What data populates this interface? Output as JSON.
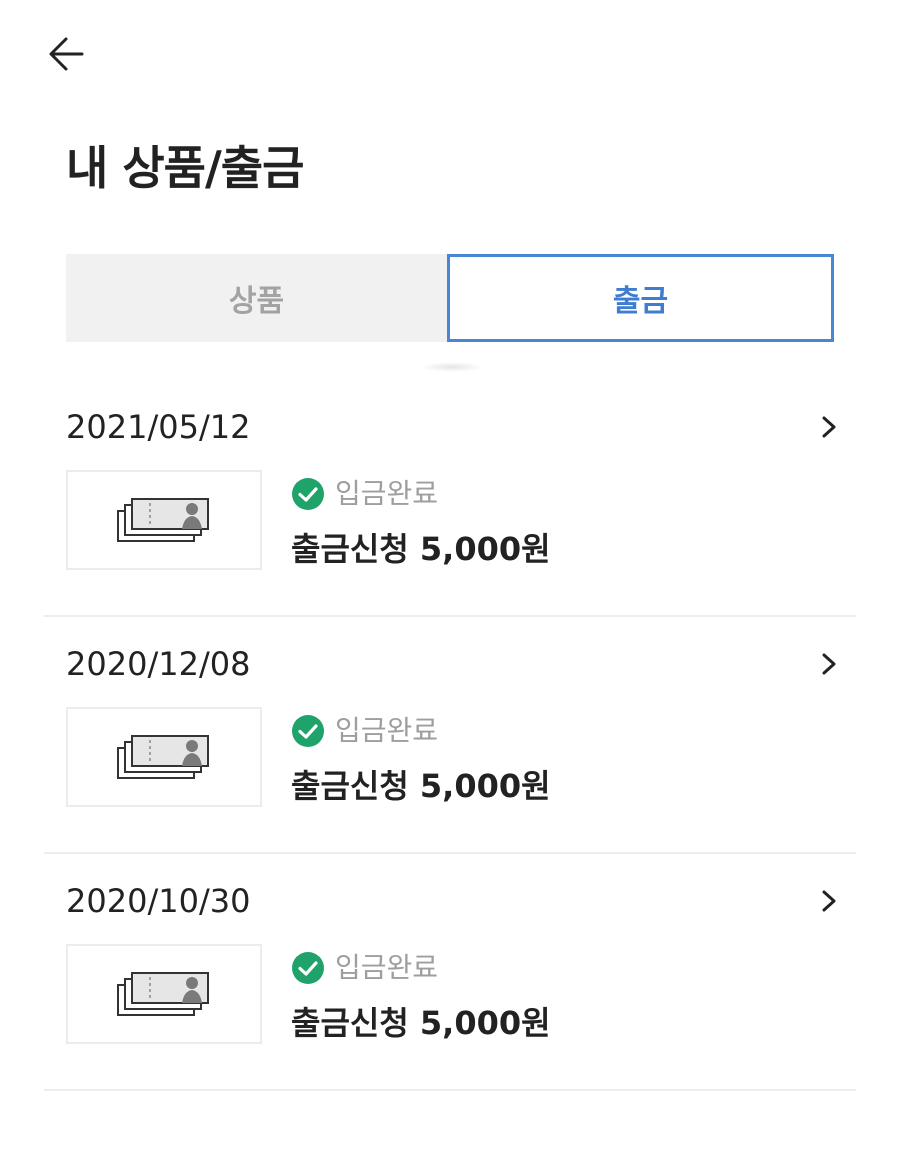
{
  "header": {
    "back_icon": "arrow-left-icon",
    "title": "내 상품/출금"
  },
  "tabs": [
    {
      "label": "상품",
      "active": false
    },
    {
      "label": "출금",
      "active": true
    }
  ],
  "colors": {
    "accent": "#4a86d4",
    "status_green": "#1fa36b",
    "inactive_tab_bg": "#f1f1f1"
  },
  "withdrawals": [
    {
      "date": "2021/05/12",
      "status": "입금완료",
      "amount": "출금신청 5,000원"
    },
    {
      "date": "2020/12/08",
      "status": "입금완료",
      "amount": "출금신청 5,000원"
    },
    {
      "date": "2020/10/30",
      "status": "입금완료",
      "amount": "출금신청 5,000원"
    }
  ]
}
